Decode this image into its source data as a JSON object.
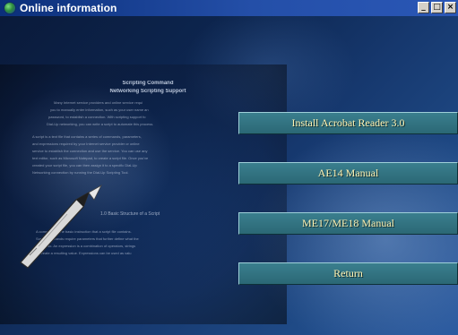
{
  "window": {
    "title": "Online information",
    "controls": {
      "minimize": "_",
      "maximize": "□",
      "close": "×"
    },
    "icon": "globe-icon"
  },
  "book_page": {
    "heading_lines": [
      "Scripting Command",
      "Networking Scripting Support"
    ],
    "paragraph1": [
      "Many Internet service providers and online service requi",
      "you to manually enter information, such as your user name an",
      "password, to establish a connection. With scripting support fo",
      "Dial-Up networking, you can write a script to automate this process."
    ],
    "paragraph2": [
      "A script is a text file that contains a series of commands, parameters,",
      "and expressions required by your Internet service provider or online",
      "service to establish the connection and use the service. You can use any",
      "text editor, such as Microsoft Notepad, to create a script file. Once you've",
      "created your script file, you can then assign it to a specific Dial-Up",
      "Networking connection by running the Dial-Up Scripting Tool."
    ],
    "section_heading": "1.0  Basic Structure of a Script",
    "paragraph3": [
      "A command is the basic instruction that a script file contains.",
      "Some commands require parameters that further define what the",
      "should do. An expression is a combination of operators, strings",
      "to create a resulting value. Expressions can be used as valu"
    ],
    "decoration": "pen-icon"
  },
  "menu": {
    "install_reader": "Install Acrobat Reader 3.0",
    "ae14_manual": "AE14 Manual",
    "me17_manual": "ME17/ME18 Manual",
    "return": "Return"
  },
  "colors": {
    "button_face": "#2b6875",
    "button_text": "#fff3b3",
    "titlebar": "#0b2f7a"
  }
}
